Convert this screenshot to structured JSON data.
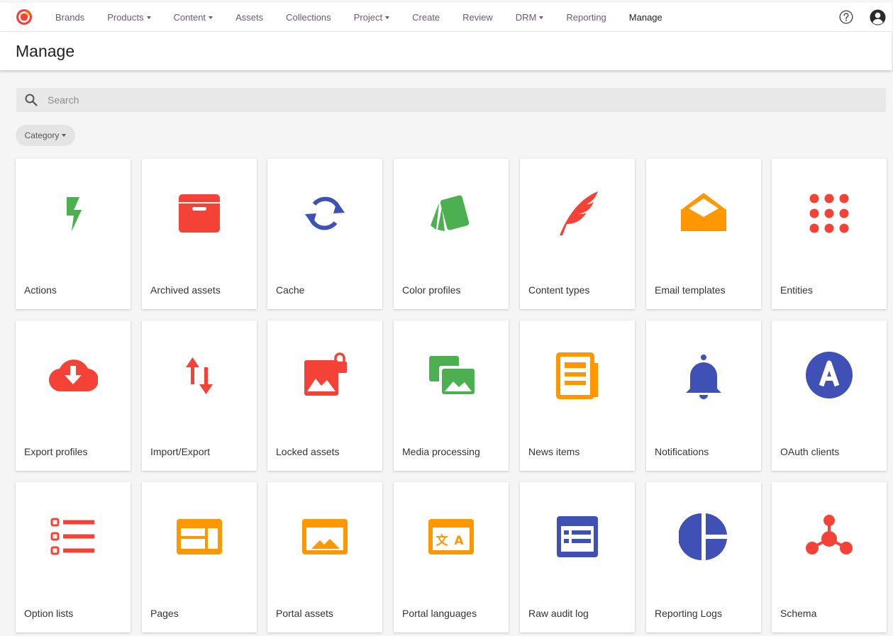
{
  "topnav": {
    "items": [
      {
        "label": "Brands",
        "dropdown": false
      },
      {
        "label": "Products",
        "dropdown": true
      },
      {
        "label": "Content",
        "dropdown": true
      },
      {
        "label": "Assets",
        "dropdown": false
      },
      {
        "label": "Collections",
        "dropdown": false
      },
      {
        "label": "Project",
        "dropdown": true
      },
      {
        "label": "Create",
        "dropdown": false
      },
      {
        "label": "Review",
        "dropdown": false
      },
      {
        "label": "DRM",
        "dropdown": true
      },
      {
        "label": "Reporting",
        "dropdown": false
      },
      {
        "label": "Manage",
        "dropdown": false,
        "active": true
      }
    ],
    "help_icon": "question-circle-icon",
    "user_icon": "user-avatar-icon"
  },
  "page": {
    "title": "Manage"
  },
  "search": {
    "placeholder": "Search",
    "value": ""
  },
  "filter": {
    "category_label": "Category"
  },
  "colors": {
    "red": "#f44336",
    "green": "#4caf50",
    "blue": "#3f51b5",
    "orange": "#ff9800"
  },
  "cards": [
    {
      "label": "Actions",
      "icon": "lightning-icon",
      "color": "#4caf50"
    },
    {
      "label": "Archived assets",
      "icon": "archive-box-icon",
      "color": "#f44336"
    },
    {
      "label": "Cache",
      "icon": "sync-icon",
      "color": "#3f51b5"
    },
    {
      "label": "Color profiles",
      "icon": "swatches-icon",
      "color": "#4caf50"
    },
    {
      "label": "Content types",
      "icon": "feather-icon",
      "color": "#f44336"
    },
    {
      "label": "Email templates",
      "icon": "open-envelope-icon",
      "color": "#ff9800"
    },
    {
      "label": "Entities",
      "icon": "grid-dots-icon",
      "color": "#f44336"
    },
    {
      "label": "Export profiles",
      "icon": "cloud-download-icon",
      "color": "#f44336"
    },
    {
      "label": "Import/Export",
      "icon": "swap-arrows-icon",
      "color": "#f44336"
    },
    {
      "label": "Locked assets",
      "icon": "locked-image-icon",
      "color": "#f44336"
    },
    {
      "label": "Media processing",
      "icon": "images-icon",
      "color": "#4caf50"
    },
    {
      "label": "News items",
      "icon": "newspaper-icon",
      "color": "#ff9800"
    },
    {
      "label": "Notifications",
      "icon": "bell-icon",
      "color": "#3f51b5"
    },
    {
      "label": "OAuth clients",
      "icon": "oauth-badge-icon",
      "color": "#3f51b5"
    },
    {
      "label": "Option lists",
      "icon": "checklist-icon",
      "color": "#f44336"
    },
    {
      "label": "Pages",
      "icon": "page-layout-icon",
      "color": "#ff9800"
    },
    {
      "label": "Portal assets",
      "icon": "portal-image-icon",
      "color": "#ff9800"
    },
    {
      "label": "Portal languages",
      "icon": "translate-icon",
      "color": "#ff9800"
    },
    {
      "label": "Raw audit log",
      "icon": "log-list-icon",
      "color": "#3f51b5"
    },
    {
      "label": "Reporting Logs",
      "icon": "pie-chart-icon",
      "color": "#3f51b5"
    },
    {
      "label": "Schema",
      "icon": "schema-graph-icon",
      "color": "#f44336"
    }
  ]
}
